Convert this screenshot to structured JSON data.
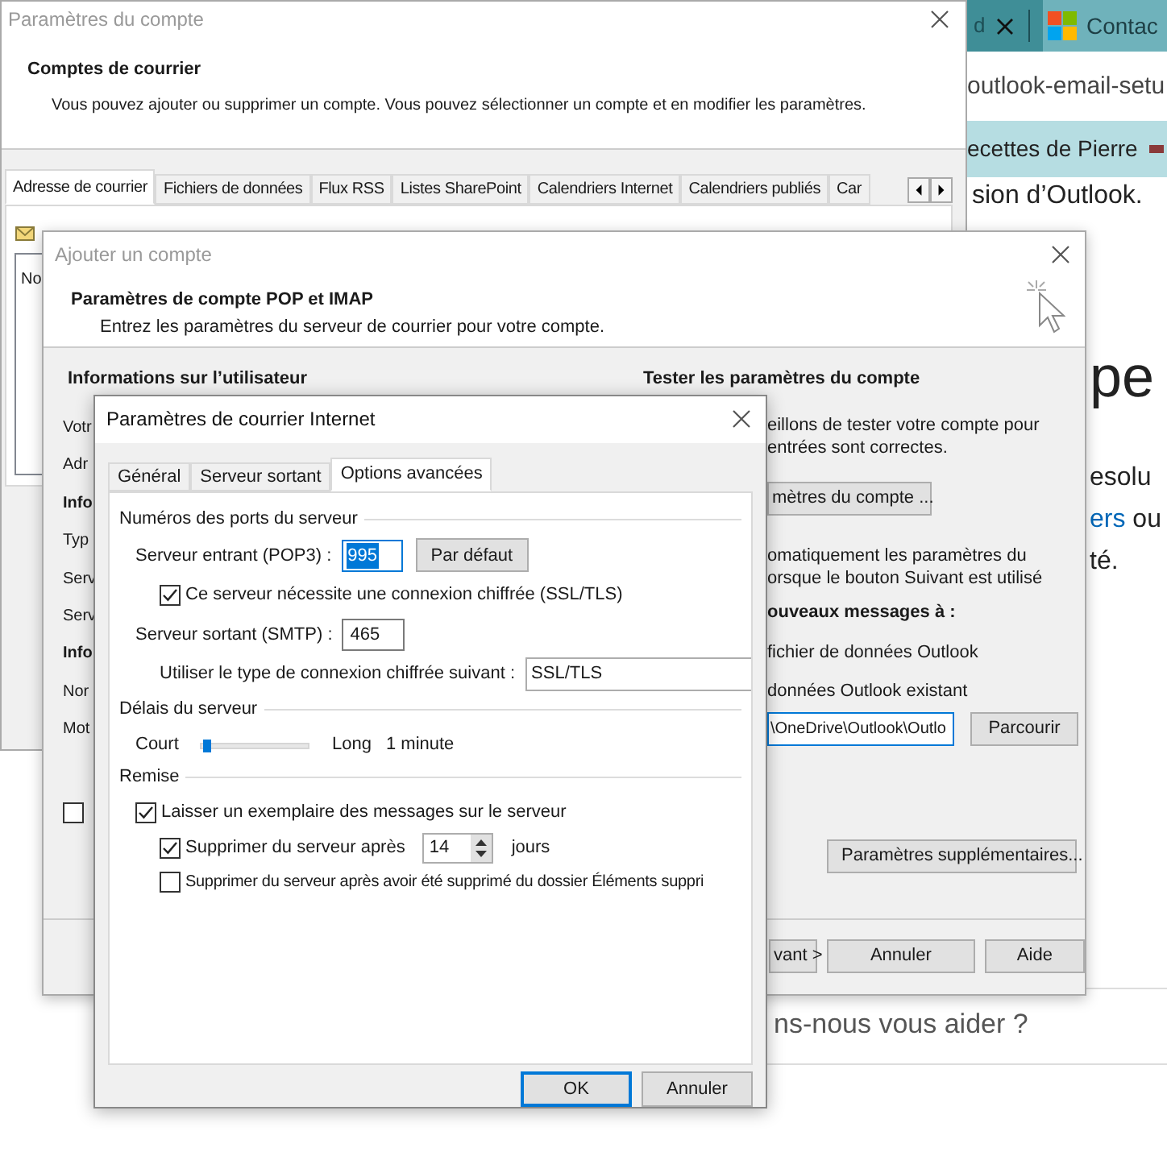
{
  "browser": {
    "tab_fragment": "d",
    "tab_title": "Contac",
    "address": "outlook-email-setu",
    "bookmark": "ecettes de Pierre",
    "intro_fragment": "sion d’Outlook.",
    "heading_fragment": "pe",
    "para_lines": [
      {
        "text": "esolu",
        "link": false
      },
      {
        "text": "ers",
        "link": true,
        "after": " ou"
      },
      {
        "text": "té.",
        "link": false
      }
    ],
    "help_fragment": "ns-nous vous aider ?"
  },
  "account_settings": {
    "title": "Paramètres du compte",
    "heading": "Comptes de courrier",
    "description": "Vous pouvez ajouter ou supprimer un compte. Vous pouvez sélectionner un compte et en modifier les paramètres.",
    "tabs": [
      {
        "label": "Adresse de courrier",
        "selected": true
      },
      {
        "label": "Fichiers de données",
        "selected": false
      },
      {
        "label": "Flux RSS",
        "selected": false
      },
      {
        "label": "Listes SharePoint",
        "selected": false
      },
      {
        "label": "Calendriers Internet",
        "selected": false
      },
      {
        "label": "Calendriers publiés",
        "selected": false
      },
      {
        "label": "Car",
        "selected": false
      }
    ],
    "list_fragment": "No"
  },
  "add_account": {
    "title": "Ajouter un compte",
    "heading": "Paramètres de compte POP et IMAP",
    "subtitle": "Entrez les paramètres du serveur de courrier pour votre compte.",
    "user_heading": "Informations sur l’utilisateur",
    "test_heading": "Tester les paramètres du compte",
    "left_fragments": [
      {
        "text": "Votr",
        "bold": false
      },
      {
        "text": "Adr",
        "bold": false
      },
      {
        "text": "Info",
        "bold": true
      },
      {
        "text": "Typ",
        "bold": false
      },
      {
        "text": "Serv",
        "bold": false
      },
      {
        "text": "Serv",
        "bold": false
      },
      {
        "text": "Info",
        "bold": true
      },
      {
        "text": "Nor",
        "bold": false
      },
      {
        "text": "Mot",
        "bold": false
      }
    ],
    "left_checkbox": {
      "checked": false
    },
    "test_lines": [
      "eillons de tester votre compte pour",
      "entrées sont correctes."
    ],
    "test_button": "mètres du compte ...",
    "auto_lines": [
      "omatiquement les paramètres du",
      "orsque le bouton Suivant est utilisé"
    ],
    "deliver_heading": "ouveaux messages à :",
    "deliver_options": [
      "fichier de données Outlook",
      "données Outlook existant"
    ],
    "file_path": "\\OneDrive\\Outlook\\Outlo",
    "browse_button": "Parcourir",
    "more_button": "Paramètres supplémentaires...",
    "buttons": [
      "vant >",
      "Annuler",
      "Aide"
    ]
  },
  "internet_settings": {
    "title": "Paramètres de courrier Internet",
    "tabs": [
      {
        "label": "Général",
        "selected": false
      },
      {
        "label": "Serveur sortant",
        "selected": false
      },
      {
        "label": "Options avancées",
        "selected": true
      }
    ],
    "ports_group": "Numéros des ports du serveur",
    "incoming_label": "Serveur entrant (POP3) :",
    "incoming_value": "995",
    "default_button": "Par défaut",
    "ssl_check": {
      "label": "Ce serveur nécessite une connexion chiffrée (SSL/TLS)",
      "checked": true
    },
    "outgoing_label": "Serveur sortant (SMTP) :",
    "outgoing_value": "465",
    "encryption_label": "Utiliser le type de connexion chiffrée suivant :",
    "encryption_value": "SSL/TLS",
    "timeout_group": "Délais du serveur",
    "timeout": {
      "min_label": "Court",
      "max_label": "Long",
      "level": 0.05,
      "reading": "1 minute"
    },
    "delivery_group": "Remise",
    "delivery_options": [
      {
        "label": "Laisser un exemplaire des messages sur le serveur",
        "checked": true,
        "children": [
          {
            "label": "Supprimer du serveur après",
            "checked": true,
            "days": "14",
            "unit": "jours"
          },
          {
            "label": "Supprimer du serveur après avoir été supprimé du dossier Éléments suppri",
            "checked": false
          }
        ]
      }
    ],
    "buttons": [
      {
        "label": "OK",
        "default": true
      },
      {
        "label": "Annuler",
        "default": false
      }
    ]
  }
}
